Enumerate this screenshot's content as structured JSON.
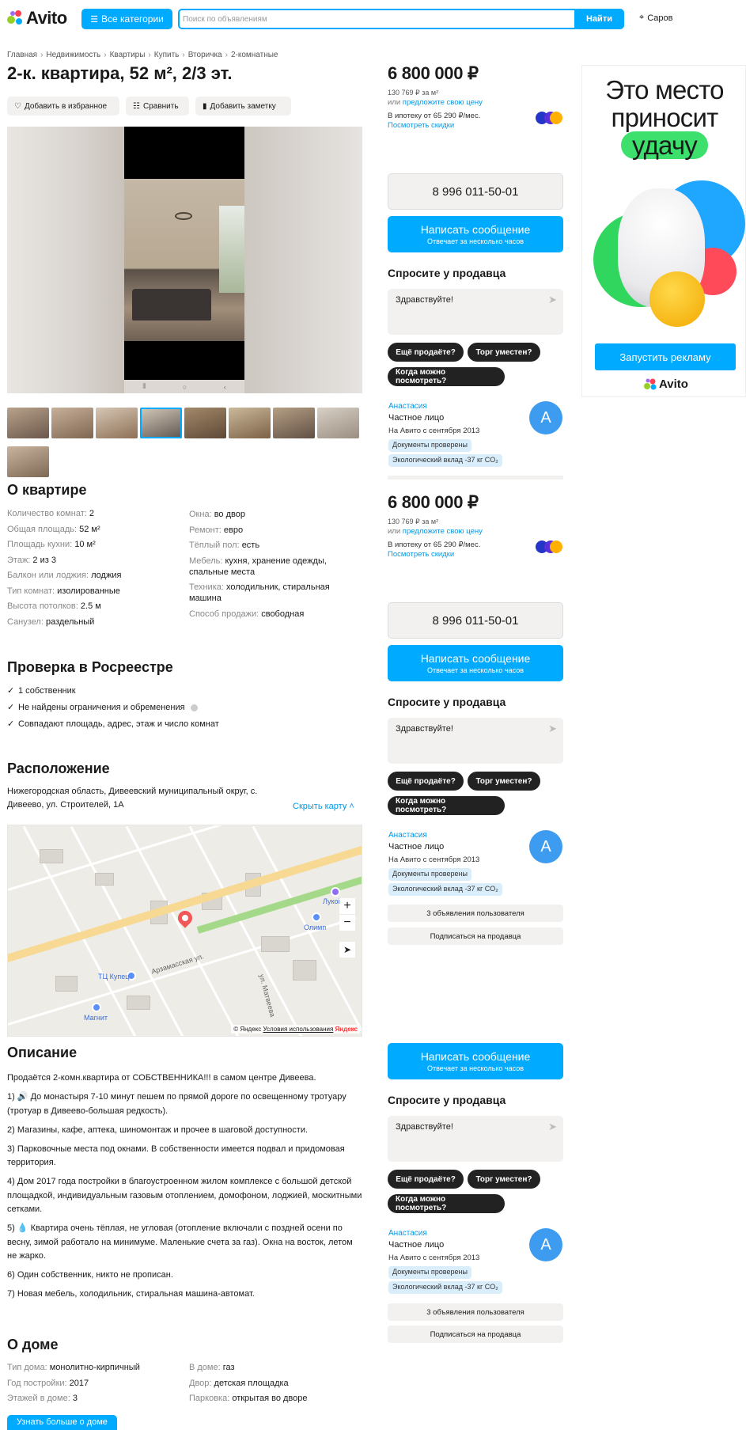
{
  "header": {
    "logo": "Avito",
    "categories_label": "Все категории",
    "search_placeholder": "Поиск по объявлениям",
    "search_button": "Найти",
    "location": "Саров"
  },
  "breadcrumb": [
    "Главная",
    "Недвижимость",
    "Квартиры",
    "Купить",
    "Вторичка",
    "2-комнатные"
  ],
  "listing": {
    "title": "2-к. квартира, 52 м², 2/3 эт.",
    "actions": {
      "favorite": "Добавить в избранное",
      "compare": "Сравнить",
      "note": "Добавить заметку"
    },
    "thumb_count_row1": 8
  },
  "about_flat": {
    "title": "О квартире",
    "left": [
      {
        "k": "Количество комнат: ",
        "v": "2"
      },
      {
        "k": "Общая площадь: ",
        "v": "52 м²"
      },
      {
        "k": "Площадь кухни: ",
        "v": "10 м²"
      },
      {
        "k": "Этаж: ",
        "v": "2 из 3"
      },
      {
        "k": "Балкон или лоджия: ",
        "v": "лоджия"
      },
      {
        "k": "Тип комнат: ",
        "v": "изолированные"
      },
      {
        "k": "Высота потолков: ",
        "v": "2.5 м"
      },
      {
        "k": "Санузел: ",
        "v": "раздельный"
      }
    ],
    "right": [
      {
        "k": "Окна: ",
        "v": "во двор"
      },
      {
        "k": "Ремонт: ",
        "v": "евро"
      },
      {
        "k": "Тёплый пол: ",
        "v": "есть"
      },
      {
        "k": "Мебель: ",
        "v": "кухня, хранение одежды, спальные места"
      },
      {
        "k": "Техника: ",
        "v": "холодильник, стиральная машина"
      },
      {
        "k": "Способ продажи: ",
        "v": "свободная"
      }
    ]
  },
  "rosreestr": {
    "title": "Проверка в Росреестре",
    "items": [
      "1 собственник",
      "Не найдены ограничения и обременения",
      "Совпадают площадь, адрес, этаж и число комнат"
    ]
  },
  "location": {
    "title": "Расположение",
    "address": "Нижегородская область, Дивеевский муниципальный округ, с. Дивеево, ул. Строителей, 1А",
    "hide_map": "Скрыть карту ˄",
    "map_labels": {
      "street1": "Арзамасская ул.",
      "street2": "ул. Матвеева",
      "poi1": "ТЦ Купец",
      "poi2": "Магнит",
      "poi3": "Олимп",
      "poi4": "Лукойл",
      "zoom_in": "+",
      "zoom_out": "−",
      "attribution": "© Яндекс",
      "terms": "Условия использования",
      "yandex": "Яндекс"
    }
  },
  "description": {
    "title": "Описание",
    "paragraphs": [
      "Продаётся 2-комн.квартира от СОБСТВЕННИКА!!! в самом центре Дивеева.",
      "1) 🔊 До монастыря 7-10 минут пешем по прямой дороге по освещенному тротуару (тротуар в Дивеево-большая редкость).",
      "2) Магазины, кафе, аптека, шиномонтаж и прочее в шаговой доступности.",
      "3) Парковочные места под окнами. В собственности имеется подвал и придомовая территория.",
      "4) Дом 2017 года постройки в благоустроенном жилом комплексе с большой детской площадкой, индивидуальным газовым отоплением, домофоном, лоджией, москитными сетками.",
      "5) 💧 Квартира очень тёплая, не угловая (отопление включали с поздней осени по весну, зимой работало на минимуме. Маленькие счета за газ). Окна на восток, летом не жарко.",
      "6) Один собственник, никто не прописан.",
      "7) Новая мебель, холодильник, стиральная машина-автомат."
    ]
  },
  "house": {
    "title": "О доме",
    "left": [
      {
        "k": "Тип дома: ",
        "v": "монолитно-кирпичный"
      },
      {
        "k": "Год постройки: ",
        "v": "2017"
      },
      {
        "k": "Этажей в доме: ",
        "v": "3"
      }
    ],
    "right": [
      {
        "k": "В доме: ",
        "v": "газ"
      },
      {
        "k": "Двор: ",
        "v": "детская площадка"
      },
      {
        "k": "Парковка: ",
        "v": "открытая во дворе"
      }
    ],
    "more_button": "Узнать больше о доме"
  },
  "seller_panel": {
    "price": "6 800 000 ₽",
    "price_per_m2": "130 769 ₽ за м²",
    "offer_prefix": "или ",
    "offer_link": "предложите свою цену",
    "mortgage": "В ипотеку от 65 290 ₽/мес.",
    "discounts": "Посмотреть скидки",
    "phone": "8 996 011-50-01",
    "message_button": "Написать сообщение",
    "message_sub": "Отвечает за несколько часов",
    "ask_title": "Спросите у продавца",
    "ask_placeholder": "Здравствуйте!",
    "chips": [
      "Ещё продаёте?",
      "Торг уместен?",
      "Когда можно посмотреть?"
    ],
    "seller_name": "Анастасия",
    "seller_type": "Частное лицо",
    "seller_since": "На Авито с сентября 2013",
    "tag_docs": "Документы проверены",
    "tag_eco": "Экологический вклад -37 кг CO₂",
    "avatar_letter": "А",
    "listings_button": "3 объявления пользователя",
    "subscribe_button": "Подписаться на продавца"
  },
  "ad": {
    "line1": "Это место",
    "line2": "приносит",
    "line3": "удачу",
    "button": "Запустить рекламу",
    "logo": "Avito"
  }
}
